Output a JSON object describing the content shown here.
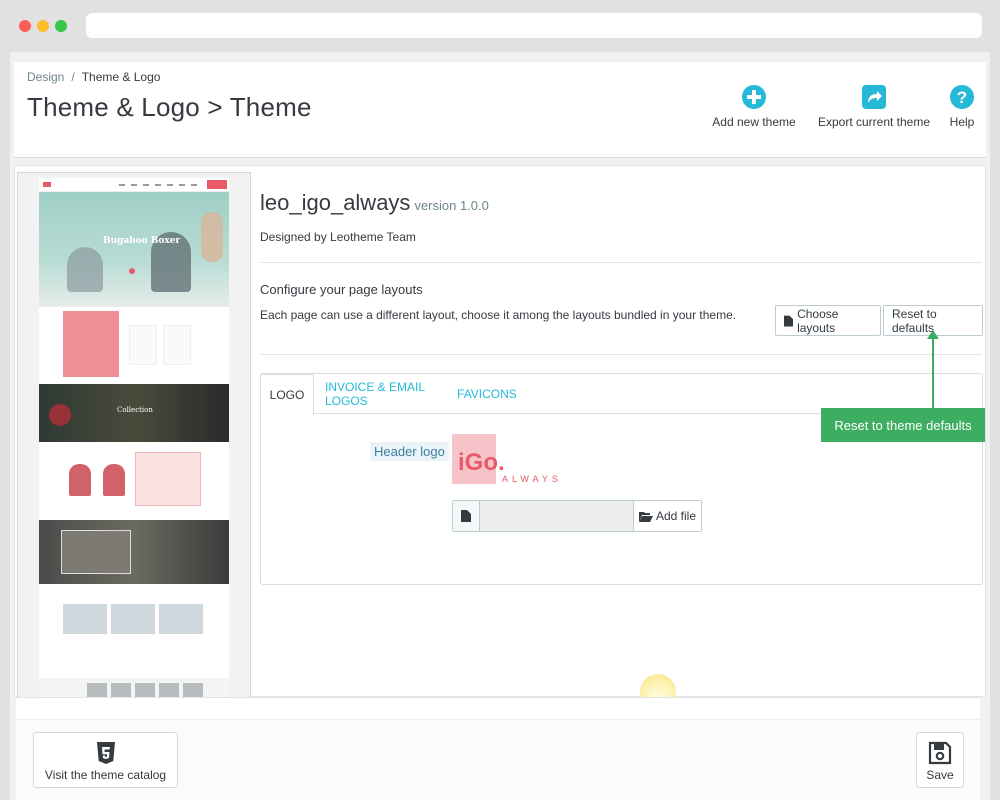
{
  "breadcrumb": {
    "parent": "Design",
    "separator": "/",
    "current": "Theme & Logo"
  },
  "page_title": "Theme & Logo > Theme",
  "toolbar": {
    "add_label": "Add new theme",
    "export_label": "Export current theme",
    "help_label": "Help",
    "icon_color": "#25b9d7"
  },
  "preview": {
    "hero_title": "Bugaboo Boxer",
    "collection_title": "Collection"
  },
  "theme": {
    "name": "leo_igo_always",
    "version": "version 1.0.0",
    "author": "Designed by Leotheme Team"
  },
  "layouts": {
    "title": "Configure your page layouts",
    "description": "Each page can use a different layout, choose it among the layouts bundled in your theme.",
    "choose_label": "Choose layouts",
    "reset_label": "Reset to defaults"
  },
  "tabs": [
    {
      "label": "LOGO",
      "active": true
    },
    {
      "label": "INVOICE & EMAIL LOGOS",
      "active": false
    },
    {
      "label": "FAVICONS",
      "active": false
    }
  ],
  "logo_tab": {
    "field_label": "Header logo",
    "logo_main": "iGo.",
    "logo_sub": "ALWAYS",
    "add_file_label": "Add file"
  },
  "callout": {
    "text": "Reset to theme defaults",
    "color": "#3dad62"
  },
  "footer": {
    "catalog_label": "Visit the theme catalog",
    "save_label": "Save"
  }
}
